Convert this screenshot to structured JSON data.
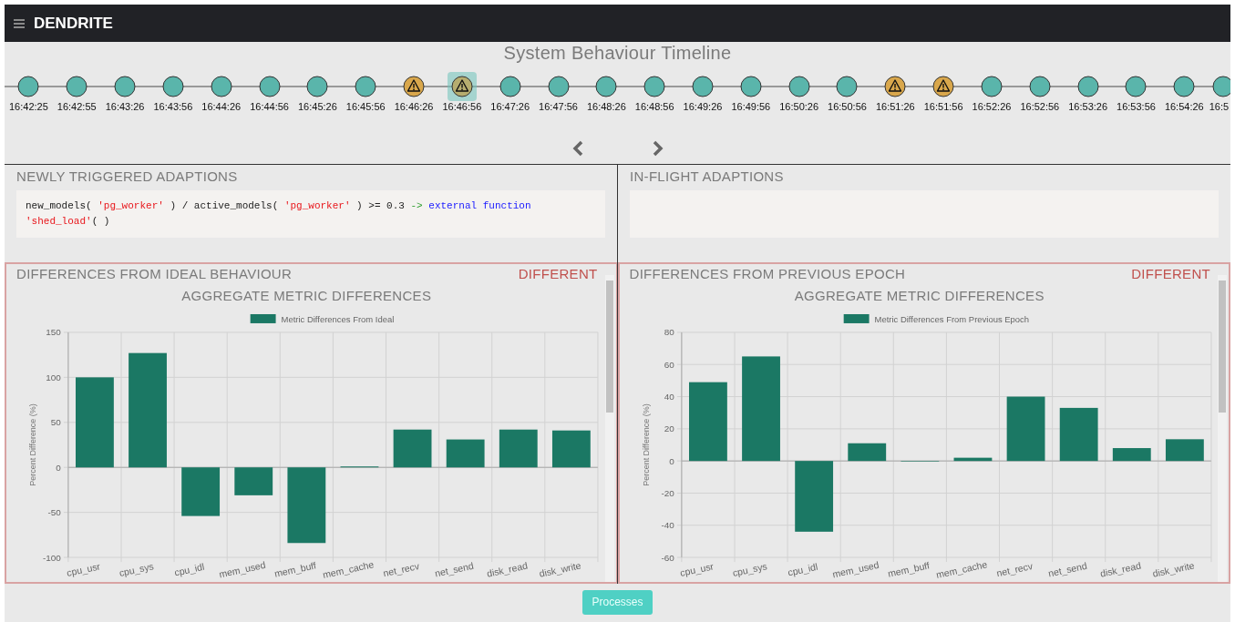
{
  "app": {
    "title": "DENDRITE"
  },
  "timeline": {
    "title": "System Behaviour Timeline",
    "nodes": [
      {
        "time": "16:42:25",
        "kind": "normal",
        "selected": false
      },
      {
        "time": "16:42:55",
        "kind": "normal",
        "selected": false
      },
      {
        "time": "16:43:26",
        "kind": "normal",
        "selected": false
      },
      {
        "time": "16:43:56",
        "kind": "normal",
        "selected": false
      },
      {
        "time": "16:44:26",
        "kind": "normal",
        "selected": false
      },
      {
        "time": "16:44:56",
        "kind": "normal",
        "selected": false
      },
      {
        "time": "16:45:26",
        "kind": "normal",
        "selected": false
      },
      {
        "time": "16:45:56",
        "kind": "normal",
        "selected": false
      },
      {
        "time": "16:46:26",
        "kind": "warning",
        "selected": false
      },
      {
        "time": "16:46:56",
        "kind": "warning",
        "selected": true
      },
      {
        "time": "16:47:26",
        "kind": "normal",
        "selected": false
      },
      {
        "time": "16:47:56",
        "kind": "normal",
        "selected": false
      },
      {
        "time": "16:48:26",
        "kind": "normal",
        "selected": false
      },
      {
        "time": "16:48:56",
        "kind": "normal",
        "selected": false
      },
      {
        "time": "16:49:26",
        "kind": "normal",
        "selected": false
      },
      {
        "time": "16:49:56",
        "kind": "normal",
        "selected": false
      },
      {
        "time": "16:50:26",
        "kind": "normal",
        "selected": false
      },
      {
        "time": "16:50:56",
        "kind": "normal",
        "selected": false
      },
      {
        "time": "16:51:26",
        "kind": "warning",
        "selected": false
      },
      {
        "time": "16:51:56",
        "kind": "warning",
        "selected": false
      },
      {
        "time": "16:52:26",
        "kind": "normal",
        "selected": false
      },
      {
        "time": "16:52:56",
        "kind": "normal",
        "selected": false
      },
      {
        "time": "16:53:26",
        "kind": "normal",
        "selected": false
      },
      {
        "time": "16:53:56",
        "kind": "normal",
        "selected": false
      },
      {
        "time": "16:54:26",
        "kind": "normal",
        "selected": false
      },
      {
        "time": "16:5",
        "kind": "normal",
        "selected": false
      }
    ]
  },
  "adaptions": [
    {
      "heading": "NEWLY TRIGGERED ADAPTIONS",
      "code": [
        {
          "kind": "plain",
          "text": "new_models( "
        },
        {
          "kind": "string",
          "text": "'pg_worker'"
        },
        {
          "kind": "plain",
          "text": " ) / active_models( "
        },
        {
          "kind": "string",
          "text": "'pg_worker'"
        },
        {
          "kind": "plain",
          "text": " ) >= 0.3 "
        },
        {
          "kind": "operator",
          "text": "->"
        },
        {
          "kind": "keyword",
          "text": " external function "
        },
        {
          "kind": "string",
          "text": "'shed_load'"
        },
        {
          "kind": "plain",
          "text": "( )"
        }
      ]
    },
    {
      "heading": "IN-FLIGHT ADAPTIONS"
    }
  ],
  "differences": [
    {
      "heading": "DIFFERENCES FROM IDEAL BEHAVIOUR",
      "status": "DIFFERENT",
      "chart_data": {
        "type": "bar",
        "title": "AGGREGATE METRIC DIFFERENCES",
        "ylabel": "Percent Difference (%)",
        "categories": [
          "cpu_usr",
          "cpu_sys",
          "cpu_idl",
          "mem_used",
          "mem_buff",
          "mem_cache",
          "net_recv",
          "net_send",
          "disk_read",
          "disk_write"
        ],
        "series": [
          {
            "name": "Metric Differences From Ideal",
            "color": "#1b7864",
            "values": [
              100,
              127,
              -54,
              -31,
              -84,
              1,
              42,
              31,
              42,
              41
            ]
          }
        ],
        "grid": true,
        "ylim": [
          -100,
          150
        ],
        "yticks": [
          -100,
          -50,
          0,
          50,
          100,
          150
        ]
      }
    },
    {
      "heading": "DIFFERENCES FROM PREVIOUS EPOCH",
      "status": "DIFFERENT",
      "chart_data": {
        "type": "bar",
        "title": "AGGREGATE METRIC DIFFERENCES",
        "ylabel": "Percent Difference (%)",
        "categories": [
          "cpu_usr",
          "cpu_sys",
          "cpu_idl",
          "mem_used",
          "mem_buff",
          "mem_cache",
          "net_recv",
          "net_send",
          "disk_read",
          "disk_write"
        ],
        "series": [
          {
            "name": "Metric Differences From Previous Epoch",
            "color": "#1b7864",
            "values": [
              49,
              65,
              -44,
              11,
              0,
              2,
              40,
              33,
              8,
              13.5
            ]
          }
        ],
        "grid": true,
        "ylim": [
          -60,
          80
        ],
        "yticks": [
          -60,
          -40,
          -20,
          0,
          20,
          40,
          60,
          80
        ]
      }
    }
  ],
  "footer": {
    "button": "Processes"
  }
}
